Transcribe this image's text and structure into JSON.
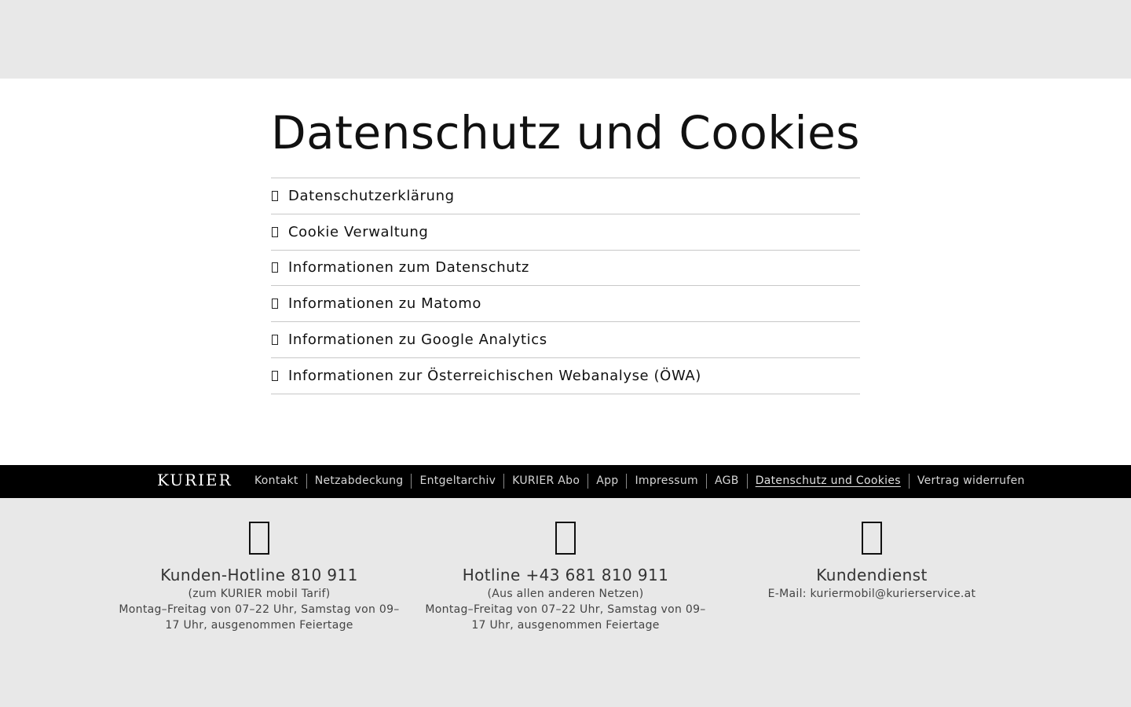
{
  "page": {
    "title": "Datenschutz und Cookies"
  },
  "accordion": {
    "items": [
      {
        "label": "Datenschutzerklärung"
      },
      {
        "label": "Cookie Verwaltung"
      },
      {
        "label": "Informationen zum Datenschutz"
      },
      {
        "label": "Informationen zu Matomo"
      },
      {
        "label": "Informationen zu Google Analytics"
      },
      {
        "label": "Informationen zur Österreichischen Webanalyse (ÖWA)"
      }
    ]
  },
  "footer": {
    "brand": "KURIER",
    "links": [
      {
        "label": "Kontakt"
      },
      {
        "label": "Netzabdeckung"
      },
      {
        "label": "Entgeltarchiv"
      },
      {
        "label": "KURIER Abo"
      },
      {
        "label": "App"
      },
      {
        "label": "Impressum"
      },
      {
        "label": "AGB"
      },
      {
        "label": "Datenschutz und Cookies",
        "active": true
      },
      {
        "label": "Vertrag widerrufen"
      }
    ]
  },
  "contacts": [
    {
      "icon": "phone-icon",
      "title": "Kunden-Hotline 810 911",
      "subtitle": "(zum KURIER mobil Tarif)",
      "hours": "Montag–Freitag von 07–22 Uhr, Samstag von 09–17 Uhr, ausgenommen Feiertage"
    },
    {
      "icon": "phone-icon",
      "title": "Hotline +43 681 810 911",
      "subtitle": "(Aus allen anderen Netzen)",
      "hours": "Montag–Freitag von 07–22 Uhr, Samstag von 09–17 Uhr, ausgenommen Feiertage"
    },
    {
      "icon": "mail-icon",
      "title": "Kundendienst",
      "subtitle": "E-Mail: kuriermobil@kurierservice.at",
      "hours": ""
    }
  ]
}
